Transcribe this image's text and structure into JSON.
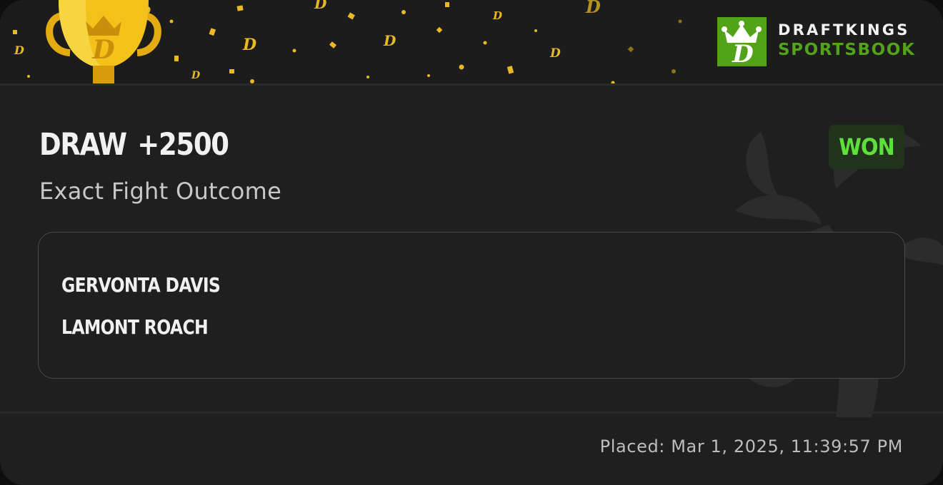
{
  "brand": {
    "line1": "DRAFTKINGS",
    "line2": "SPORTSBOOK",
    "accent_color": "#53a318"
  },
  "icons": [
    "trophy-icon",
    "draftkings-crown-icon",
    "confetti"
  ],
  "bet": {
    "selection": "DRAW",
    "odds": "+2500",
    "market": "Exact Fight Outcome",
    "status": "WON",
    "status_color": "#5ee03c"
  },
  "event": {
    "fighters": [
      "GERVONTA DAVIS",
      "LAMONT ROACH"
    ]
  },
  "footer": {
    "placed": "Placed: Mar 1, 2025, 11:39:57 PM"
  }
}
